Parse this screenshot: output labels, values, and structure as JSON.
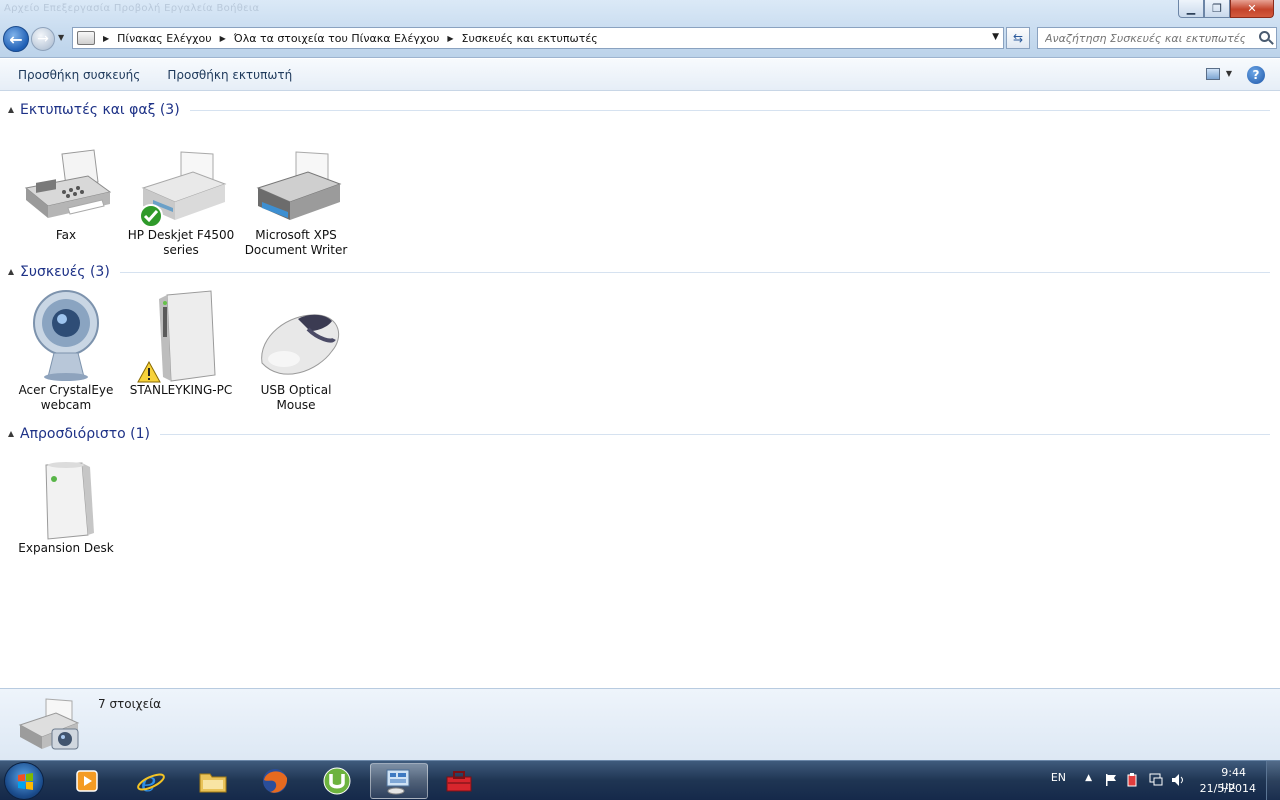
{
  "window": {
    "menu_ghost": "Αρχείο   Επεξεργασία   Προβολή   Εργαλεία   Βοήθεια",
    "buttons": {
      "minimize": "▁",
      "maximize": "❐",
      "close": "✕"
    }
  },
  "address_bar": {
    "crumbs": [
      "Πίνακας Ελέγχου",
      "Όλα τα στοιχεία του Πίνακα Ελέγχου",
      "Συσκευές και εκτυπωτές"
    ]
  },
  "search": {
    "placeholder": "Αναζήτηση Συσκευές και εκτυπωτές"
  },
  "toolbar": {
    "add_device": "Προσθήκη συσκευής",
    "add_printer": "Προσθήκη εκτυπωτή",
    "help": "?"
  },
  "groups": [
    {
      "title": "Εκτυπωτές και φαξ (3)",
      "items": [
        {
          "label": "Fax",
          "icon": "fax-icon"
        },
        {
          "label": "HP Deskjet F4500 series",
          "icon": "printer-icon",
          "badge": "default-check-icon"
        },
        {
          "label": "Microsoft XPS Document Writer",
          "icon": "printer-icon"
        }
      ]
    },
    {
      "title": "Συσκευές (3)",
      "items": [
        {
          "label": "Acer CrystalEye webcam",
          "icon": "webcam-icon"
        },
        {
          "label": "STANLEYKING-PC",
          "icon": "computer-tower-icon",
          "badge": "warning-icon"
        },
        {
          "label": "USB Optical Mouse",
          "icon": "mouse-icon"
        }
      ]
    },
    {
      "title": "Απροσδιόριστο (1)",
      "items": [
        {
          "label": "Expansion Desk",
          "icon": "external-drive-icon"
        }
      ]
    }
  ],
  "details": {
    "count": "7 στοιχεία"
  },
  "taskbar": {
    "apps": [
      "media-player-icon",
      "internet-explorer-icon",
      "file-explorer-icon",
      "firefox-icon",
      "utorrent-icon",
      "devices-printers-icon",
      "toolbox-icon"
    ],
    "language": "EN",
    "time": "9:44 μμ",
    "date": "21/5/2014"
  }
}
